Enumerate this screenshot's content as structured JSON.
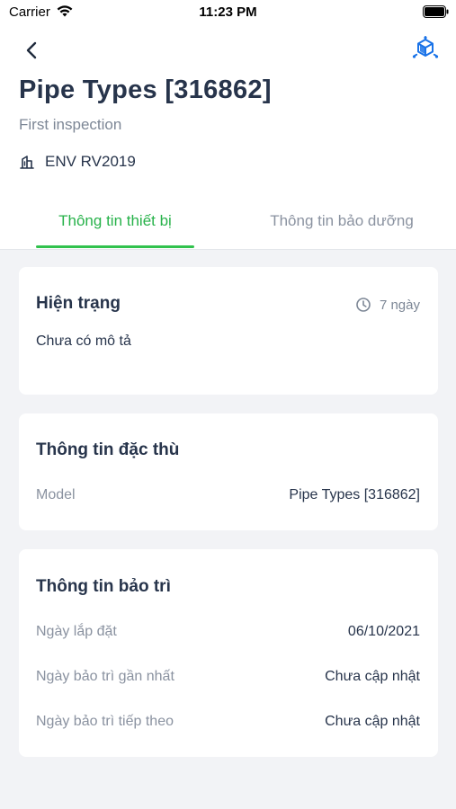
{
  "status_bar": {
    "carrier": "Carrier",
    "time": "11:23 PM"
  },
  "header": {
    "title": "Pipe Types [316862]",
    "subtitle": "First inspection",
    "building": "ENV RV2019",
    "icons": {
      "back": "chevron-left-icon",
      "model": "3d-cube-icon",
      "building": "building-icon"
    }
  },
  "tabs": [
    {
      "label": "Thông tin thiết bị",
      "active": true
    },
    {
      "label": "Thông tin bảo dưỡng",
      "active": false
    }
  ],
  "colors": {
    "accent": "#31c24d",
    "accent_text": "#27b24a",
    "title": "#27344b",
    "muted": "#8a92a0",
    "background": "#f2f3f6",
    "icon_blue": "#1a73e8"
  },
  "status_card": {
    "title": "Hiện trạng",
    "time_ago": "7 ngày",
    "description": "Chưa có mô tả"
  },
  "spec_card": {
    "title": "Thông tin đặc thù",
    "rows": [
      {
        "label": "Model",
        "value": "Pipe Types [316862]"
      }
    ]
  },
  "maintenance_card": {
    "title": "Thông tin bảo trì",
    "rows": [
      {
        "label": "Ngày lắp đặt",
        "value": "06/10/2021"
      },
      {
        "label": "Ngày bảo trì gần nhất",
        "value": "Chưa cập nhật"
      },
      {
        "label": "Ngày bảo trì tiếp theo",
        "value": "Chưa cập nhật"
      }
    ]
  }
}
